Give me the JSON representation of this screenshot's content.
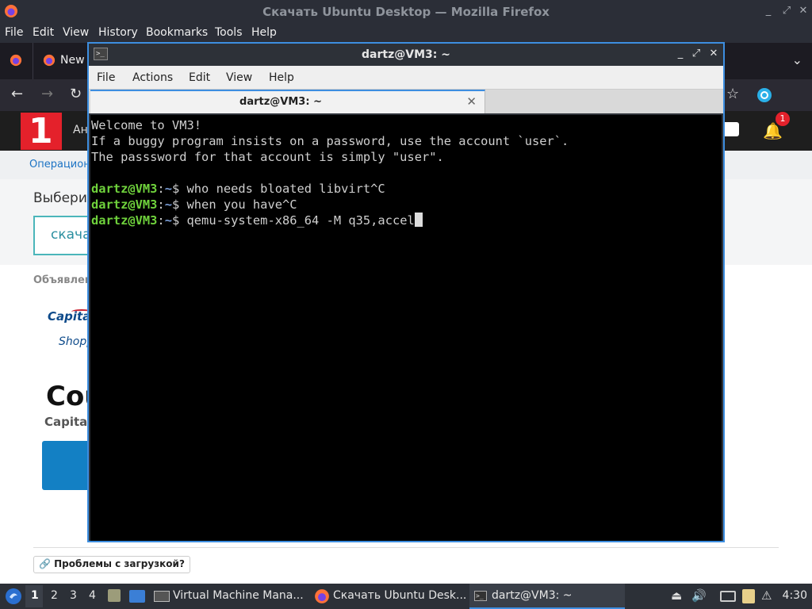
{
  "firefox": {
    "window_title": "Скачать Ubuntu Desktop — Mozilla Firefox",
    "menu": [
      "File",
      "Edit",
      "View",
      "History",
      "Bookmarks",
      "Tools",
      "Help"
    ],
    "tab_label": "New",
    "page": {
      "header_text": "Ан",
      "logo_text": "1",
      "notification_count": "1",
      "breadcrumb": "Операцион",
      "select_title": "Выберит",
      "download_button": "скача",
      "ad_label": "Объявлен",
      "ad_brand": "Capita",
      "ad_brand_sub": "Shopp",
      "ad_headline": "Cou",
      "ad_sub": "Capital",
      "problems_link": "🔗 Проблемы с загрузкой?"
    }
  },
  "terminal": {
    "window_title": "dartz@VM3: ~",
    "menu": [
      "File",
      "Actions",
      "Edit",
      "View",
      "Help"
    ],
    "tab_label": "dartz@VM3: ~",
    "motd": [
      "Welcome to VM3!",
      "If a buggy program insists on a password, use the account `user`.",
      "The passsword for that account is simply \"user\"."
    ],
    "prompt_user": "dartz@VM3",
    "prompt_sep": ":",
    "prompt_path": "~",
    "prompt_end": "$ ",
    "history": [
      "who needs bloated libvirt^C",
      "when you have^C"
    ],
    "current_command": "qemu-system-x86_64 -M q35,accel"
  },
  "taskbar": {
    "workspaces": [
      "1",
      "2",
      "3",
      "4"
    ],
    "tasks": [
      "Virtual Machine Mana...",
      "Скачать Ubuntu Desk...",
      "dartz@VM3: ~"
    ],
    "clock": "4:30"
  }
}
